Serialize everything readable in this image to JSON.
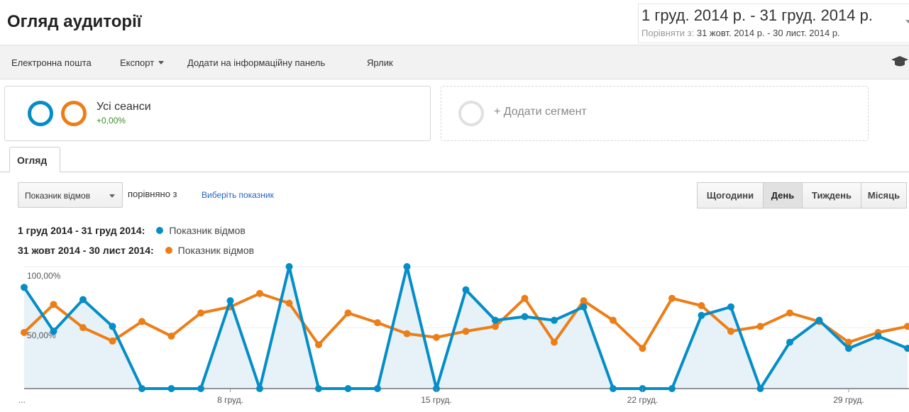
{
  "header": {
    "title": "Огляд аудиторії",
    "date_range": "1 груд. 2014 р. - 31 груд. 2014 р.",
    "compare_label": "Порівняти з:",
    "compare_range": "31 жовт. 2014 р. - 30 лист. 2014 р."
  },
  "toolbar": {
    "email": "Електронна пошта",
    "export": "Експорт",
    "add_dashboard": "Додати на інформаційну панель",
    "shortcut": "Ярлик"
  },
  "segments": {
    "active_name": "Усі сеанси",
    "active_change": "+0,00%",
    "add_label": "+ Додати сегмент"
  },
  "tabs": {
    "overview": "Огляд"
  },
  "controls": {
    "metric": "Показник відмов",
    "compared_with": "порівняно з",
    "select_metric": "Виберіть показник",
    "granularity": [
      "Щогодини",
      "День",
      "Тиждень",
      "Місяць"
    ],
    "active_granularity": "День"
  },
  "colors": {
    "current": "#058dc7",
    "previous": "#ed7e17",
    "fill": "#e6f2f8",
    "accent_link": "#2266bb",
    "positive": "#3a8c2c"
  },
  "icons": {
    "settings": "graduation-cap-icon"
  },
  "chart_data": {
    "type": "line",
    "y_ticks": [
      "100,00%",
      "50,00%"
    ],
    "ylim": [
      0,
      100
    ],
    "x_tick_labels": [
      "...",
      "8 груд.",
      "15 груд.",
      "22 груд.",
      "29 груд."
    ],
    "x_tick_days": [
      1,
      8,
      15,
      22,
      29
    ],
    "series": [
      {
        "name": "Показник відмов",
        "range_label": "1 груд 2014 - 31 груд 2014:",
        "color": "#058dc7",
        "values": [
          83,
          47,
          73,
          51,
          0,
          0,
          0,
          72,
          0,
          100,
          0,
          0,
          0,
          100,
          0,
          81,
          56,
          59,
          56,
          67,
          0,
          0,
          0,
          60,
          67,
          0,
          38,
          56,
          33,
          43,
          33
        ]
      },
      {
        "name": "Показник відмов",
        "range_label": "31 жовт 2014 - 30 лист 2014:",
        "color": "#ed7e17",
        "values": [
          46,
          69,
          50,
          39,
          55,
          43,
          62,
          67,
          78,
          70,
          36,
          62,
          54,
          45,
          42,
          47,
          51,
          74,
          38,
          72,
          56,
          33,
          74,
          68,
          47,
          51,
          62,
          55,
          38,
          46,
          51
        ]
      }
    ]
  }
}
